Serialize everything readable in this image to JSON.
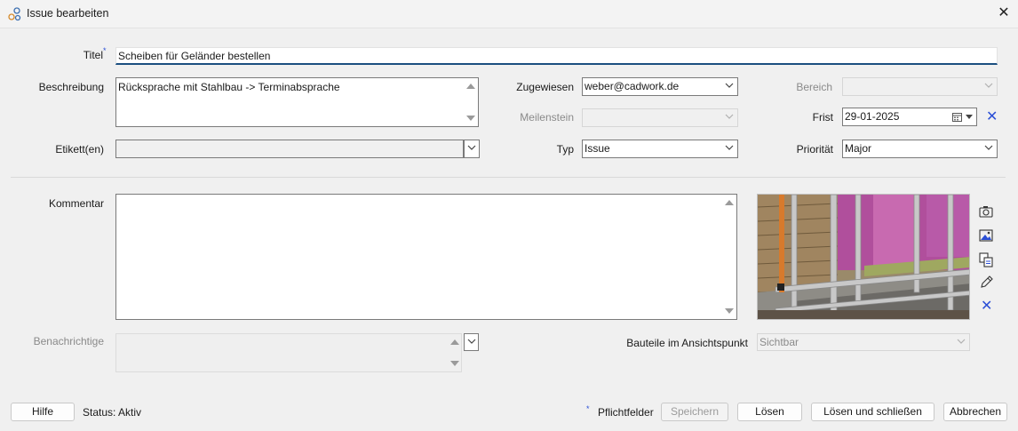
{
  "window": {
    "title": "Issue bearbeiten",
    "close_icon": "close-icon",
    "app_icon": "cadwork-issue-icon"
  },
  "form": {
    "title_label": "Titel",
    "title_value": "Scheiben für Geländer bestellen",
    "description_label": "Beschreibung",
    "description_value": "Rücksprache mit Stahlbau -> Terminabsprache",
    "tags_label": "Etikett(en)",
    "tags_value": "",
    "assigned_label": "Zugewiesen",
    "assigned_value": "weber@cadwork.de",
    "milestone_label": "Meilenstein",
    "milestone_value": "",
    "type_label": "Typ",
    "type_value": "Issue",
    "area_label": "Bereich",
    "area_value": "",
    "deadline_label": "Frist",
    "deadline_value": "29-01-2025",
    "priority_label": "Priorität",
    "priority_value": "Major",
    "comment_label": "Kommentar",
    "comment_value": "",
    "notified_label": "Benachrichtige",
    "viewpoint_label": "Bauteile im Ansichtspunkt",
    "viewpoint_value": "Sichtbar"
  },
  "side_tools": [
    "camera-icon",
    "image-icon",
    "copy-icon",
    "pencil-icon",
    "delete-x-icon"
  ],
  "footer": {
    "help": "Hilfe",
    "status": "Status: Aktiv",
    "required_marker": "*",
    "required_label": "Pflichtfelder",
    "save": "Speichern",
    "solve": "Lösen",
    "solve_close": "Lösen und schließen",
    "cancel": "Abbrechen"
  },
  "colors": {
    "accent": "#2b4fd6",
    "active_underline": "#1b4f80"
  }
}
